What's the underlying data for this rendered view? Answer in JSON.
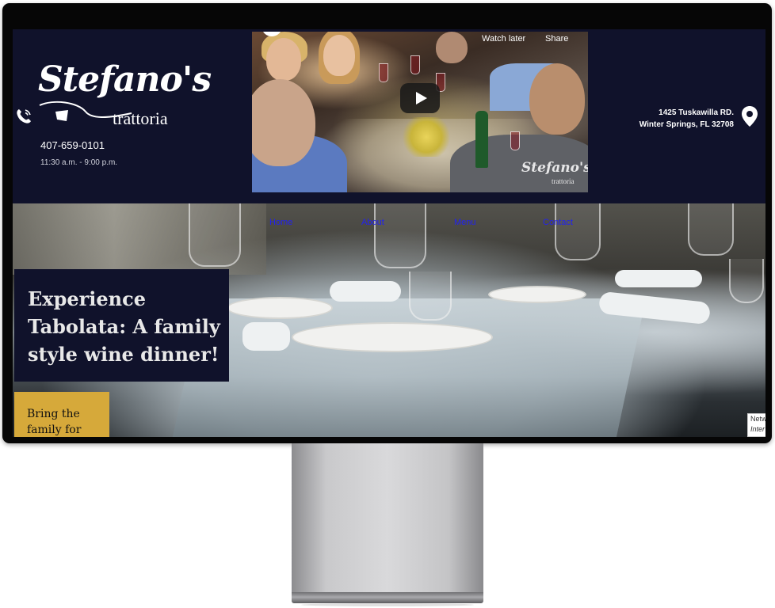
{
  "header": {
    "logo_script": "Stefano's",
    "logo_subtitle": "trattoria",
    "phone": "407-659-0101",
    "hours": "11:30 a.m. - 9:00 p.m.",
    "address_line1": "1425 Tuskawilla RD.",
    "address_line2": "Winter Springs, FL 32708"
  },
  "video": {
    "watch_later": "Watch later",
    "share": "Share",
    "watermark": "Stefano's",
    "watermark_sub": "trattoria"
  },
  "nav": {
    "items": [
      "Home",
      "About",
      "Menu",
      "Contact"
    ]
  },
  "hero": {
    "headline": "Experience Tabolata: A family style wine dinner!",
    "cta": "Bring the family for"
  },
  "badge": {
    "line1": "Netw",
    "line2": "Inter"
  }
}
